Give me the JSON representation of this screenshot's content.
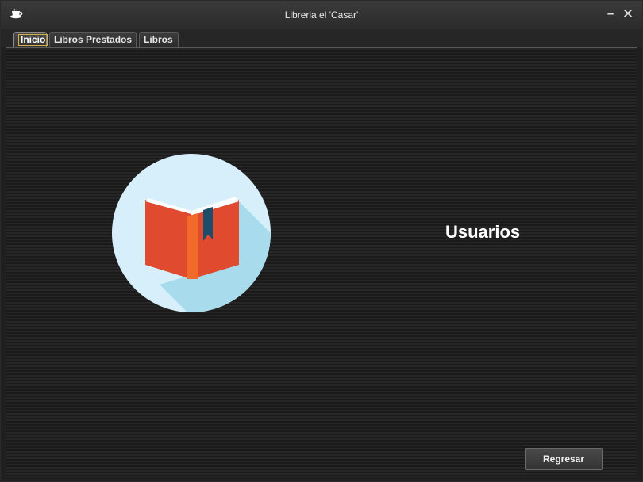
{
  "window": {
    "title": "Libreria el 'Casar'",
    "minimize_glyph": "–",
    "close_glyph": "✕",
    "app_icon": "coffee-cup-icon"
  },
  "tabs": [
    {
      "label": "Inicio",
      "active": true
    },
    {
      "label": "Libros Prestados",
      "active": false
    },
    {
      "label": "Libros",
      "active": false
    }
  ],
  "main": {
    "logo_icon": "open-book-icon",
    "section_title": "Usuarios",
    "back_button_label": "Regresar"
  },
  "colors": {
    "background": "#1f1f1f",
    "circle": "#d6effb",
    "circle_shadow": "#a8dcec",
    "book_red": "#e04a2f",
    "book_spine": "#f26a2a",
    "bookmark": "#1d4d6b"
  }
}
